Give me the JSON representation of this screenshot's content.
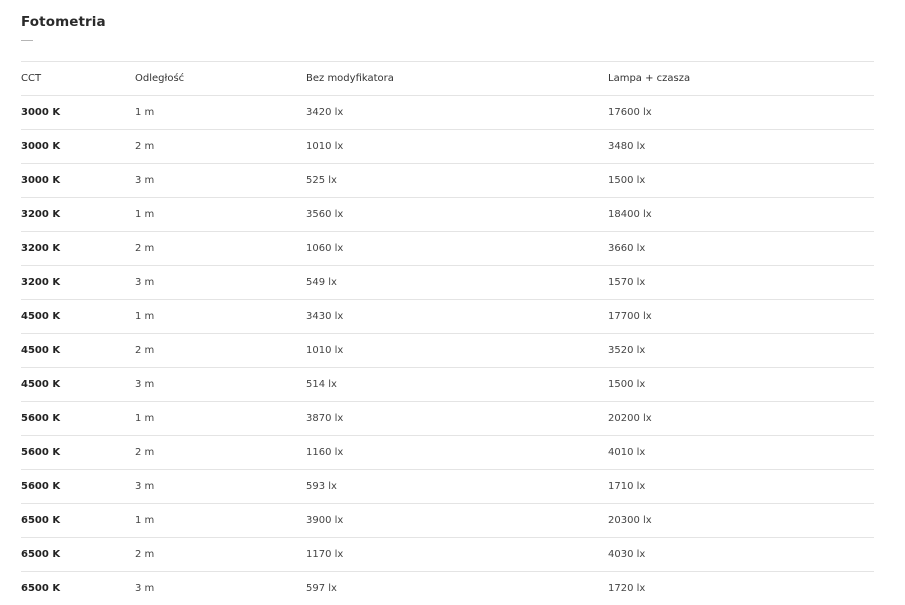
{
  "section": {
    "title": "Fotometria"
  },
  "table": {
    "headers": [
      "CCT",
      "Odległość",
      "Bez modyfikatora",
      "Lampa + czasza"
    ],
    "rows": [
      [
        "3000 K",
        "1 m",
        "3420 lx",
        "17600 lx"
      ],
      [
        "3000 K",
        "2 m",
        "1010 lx",
        "3480 lx"
      ],
      [
        "3000 K",
        "3 m",
        "525 lx",
        "1500 lx"
      ],
      [
        "3200 K",
        "1 m",
        "3560 lx",
        "18400 lx"
      ],
      [
        "3200 K",
        "2 m",
        "1060 lx",
        "3660 lx"
      ],
      [
        "3200 K",
        "3 m",
        "549 lx",
        "1570 lx"
      ],
      [
        "4500 K",
        "1 m",
        "3430 lx",
        "17700 lx"
      ],
      [
        "4500 K",
        "2 m",
        "1010 lx",
        "3520 lx"
      ],
      [
        "4500 K",
        "3 m",
        "514 lx",
        "1500 lx"
      ],
      [
        "5600 K",
        "1 m",
        "3870 lx",
        "20200 lx"
      ],
      [
        "5600 K",
        "2 m",
        "1160 lx",
        "4010 lx"
      ],
      [
        "5600 K",
        "3 m",
        "593 lx",
        "1710 lx"
      ],
      [
        "6500 K",
        "1 m",
        "3900 lx",
        "20300 lx"
      ],
      [
        "6500 K",
        "2 m",
        "1170 lx",
        "4030 lx"
      ],
      [
        "6500 K",
        "3 m",
        "597 lx",
        "1720 lx"
      ]
    ]
  }
}
